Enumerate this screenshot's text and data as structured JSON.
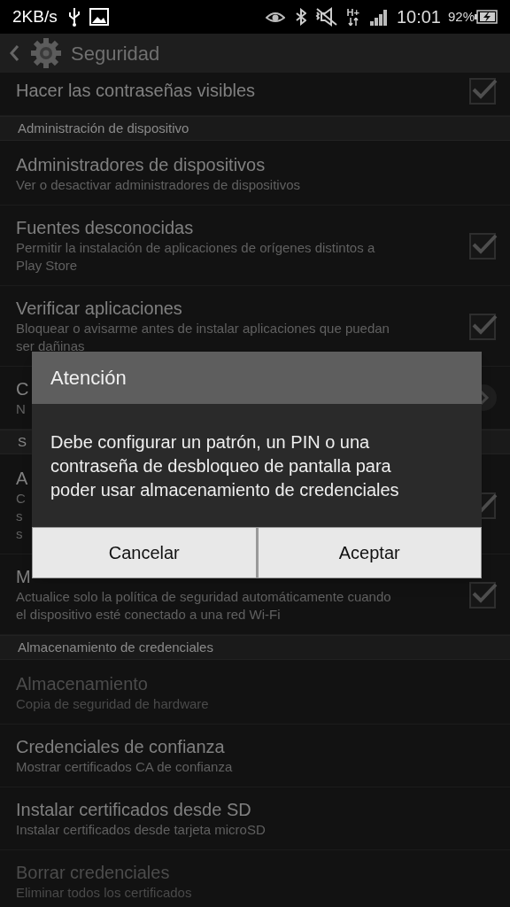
{
  "status_bar": {
    "speed": "2KB/s",
    "network": "H+",
    "time": "10:01",
    "battery": "92%"
  },
  "action_bar": {
    "title": "Seguridad"
  },
  "settings": [
    {
      "kind": "check",
      "title": "Hacer las contraseñas visibles",
      "checked": true,
      "disabled": false
    },
    {
      "kind": "header",
      "title": "Administración de dispositivo"
    },
    {
      "kind": "item",
      "title": "Administradores de dispositivos",
      "subtitle": "Ver o desactivar administradores de dispositivos",
      "disabled": false
    },
    {
      "kind": "check",
      "title": "Fuentes desconocidas",
      "subtitle": "Permitir la instalación de aplicaciones de orígenes distintos a\nPlay Store",
      "checked": true,
      "disabled": false
    },
    {
      "kind": "check",
      "title": "Verificar aplicaciones",
      "subtitle": "Bloquear o avisarme antes de instalar aplicaciones que puedan\nser dañinas",
      "checked": true,
      "disabled": false
    },
    {
      "kind": "link",
      "title": "C",
      "subtitle": "N",
      "disabled": false
    },
    {
      "kind": "header",
      "title": "S"
    },
    {
      "kind": "check",
      "title": "A",
      "subtitle": "C\ns\ns",
      "checked": true,
      "disabled": false
    },
    {
      "kind": "check",
      "title": "M",
      "subtitle": "Actualice solo la política de seguridad automáticamente cuando\nel dispositivo esté conectado a una red Wi-Fi",
      "checked": true,
      "disabled": false
    },
    {
      "kind": "header",
      "title": "Almacenamiento de credenciales"
    },
    {
      "kind": "item",
      "title": "Almacenamiento",
      "subtitle": "Copia de seguridad de hardware",
      "disabled": true
    },
    {
      "kind": "item",
      "title": "Credenciales de confianza",
      "subtitle": "Mostrar certificados CA de confianza",
      "disabled": false
    },
    {
      "kind": "item",
      "title": "Instalar certificados desde SD",
      "subtitle": "Instalar certificados desde tarjeta microSD",
      "disabled": false
    },
    {
      "kind": "item",
      "title": "Borrar credenciales",
      "subtitle": "Eliminar todos los certificados",
      "disabled": true
    }
  ],
  "dialog": {
    "title": "Atención",
    "message": "Debe configurar un patrón, un PIN o una contraseña de desbloqueo de pantalla para poder usar almacenamiento de credenciales",
    "buttons": [
      "Cancelar",
      "Aceptar"
    ]
  }
}
